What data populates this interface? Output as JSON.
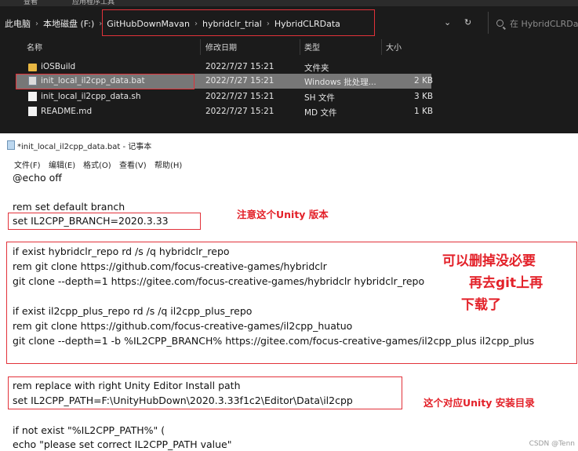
{
  "explorer": {
    "menu": [
      "查看",
      "应用程序工具"
    ],
    "breadcrumb": [
      "此电脑",
      "本地磁盘 (F:)",
      "GitHubDownMavan",
      "hybridclr_trial",
      "HybridCLRData"
    ],
    "search_placeholder": "在 HybridCLRData",
    "columns": {
      "name": "名称",
      "date": "修改日期",
      "type": "类型",
      "size": "大小"
    },
    "files": [
      {
        "name": "iOSBuild",
        "date": "2022/7/27 15:21",
        "type": "文件夹",
        "size": ""
      },
      {
        "name": "init_local_il2cpp_data.bat",
        "date": "2022/7/27 15:21",
        "type": "Windows 批处理...",
        "size": "2 KB"
      },
      {
        "name": "init_local_il2cpp_data.sh",
        "date": "2022/7/27 15:21",
        "type": "SH 文件",
        "size": "3 KB"
      },
      {
        "name": "README.md",
        "date": "2022/7/27 15:21",
        "type": "MD 文件",
        "size": "1 KB"
      }
    ]
  },
  "notepad": {
    "title": "*init_local_il2cpp_data.bat - 记事本",
    "menu": [
      "文件(F)",
      "编辑(E)",
      "格式(O)",
      "查看(V)",
      "帮助(H)"
    ],
    "lines": [
      "@echo off",
      "",
      "rem set default branch",
      "set IL2CPP_BRANCH=2020.3.33",
      "",
      "if exist hybridclr_repo rd /s /q hybridclr_repo",
      "rem git clone https://github.com/focus-creative-games/hybridclr",
      "git clone --depth=1 https://gitee.com/focus-creative-games/hybridclr hybridclr_repo",
      "",
      "if exist il2cpp_plus_repo rd /s /q il2cpp_plus_repo",
      "rem git clone https://github.com/focus-creative-games/il2cpp_huatuo",
      "git clone --depth=1 -b %IL2CPP_BRANCH% https://gitee.com/focus-creative-games/il2cpp_plus il2cpp_plus",
      "",
      "rem replace with right Unity Editor Install path",
      "set IL2CPP_PATH=F:\\UnityHubDown\\2020.3.33f1c2\\Editor\\Data\\il2cpp",
      "",
      "if not exist \"%IL2CPP_PATH%\" (",
      "    echo \"please set correct IL2CPP_PATH value\""
    ]
  },
  "annotations": {
    "unity_version": "注意这个Unity 版本",
    "can_delete_1": "可以删掉没必要",
    "can_delete_2": "再去git上再",
    "can_delete_3": "下载了",
    "install_dir": "这个对应Unity 安装目录"
  },
  "watermark": "CSDN @Tenn",
  "colors": {
    "annotation_red": "#e32129",
    "explorer_bg": "#1b1b1b",
    "selection": "#777777"
  }
}
